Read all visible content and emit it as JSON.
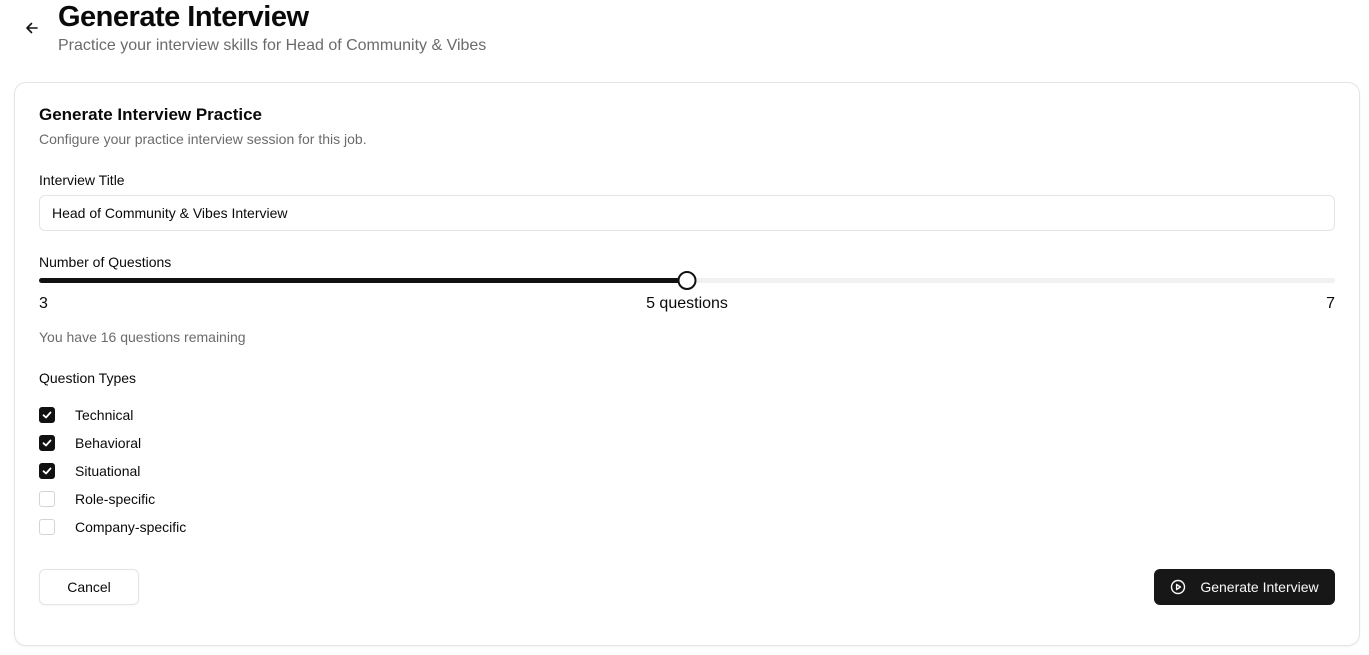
{
  "header": {
    "title": "Generate Interview",
    "subtitle": "Practice your interview skills for Head of Community & Vibes"
  },
  "card": {
    "title": "Generate Interview Practice",
    "description": "Configure your practice interview session for this job."
  },
  "interview_title": {
    "label": "Interview Title",
    "value": "Head of Community & Vibes Interview"
  },
  "questions": {
    "label": "Number of Questions",
    "min": "3",
    "max": "7",
    "value": 5,
    "value_label": "5 questions",
    "remaining": "You have 16 questions remaining"
  },
  "question_types": {
    "label": "Question Types",
    "items": [
      {
        "label": "Technical",
        "checked": true
      },
      {
        "label": "Behavioral",
        "checked": true
      },
      {
        "label": "Situational",
        "checked": true
      },
      {
        "label": "Role-specific",
        "checked": false
      },
      {
        "label": "Company-specific",
        "checked": false
      }
    ]
  },
  "actions": {
    "cancel": "Cancel",
    "generate": "Generate Interview"
  },
  "icons": {
    "back": "arrow-left-icon",
    "generate": "play-circle-icon",
    "checked": "check-icon"
  }
}
